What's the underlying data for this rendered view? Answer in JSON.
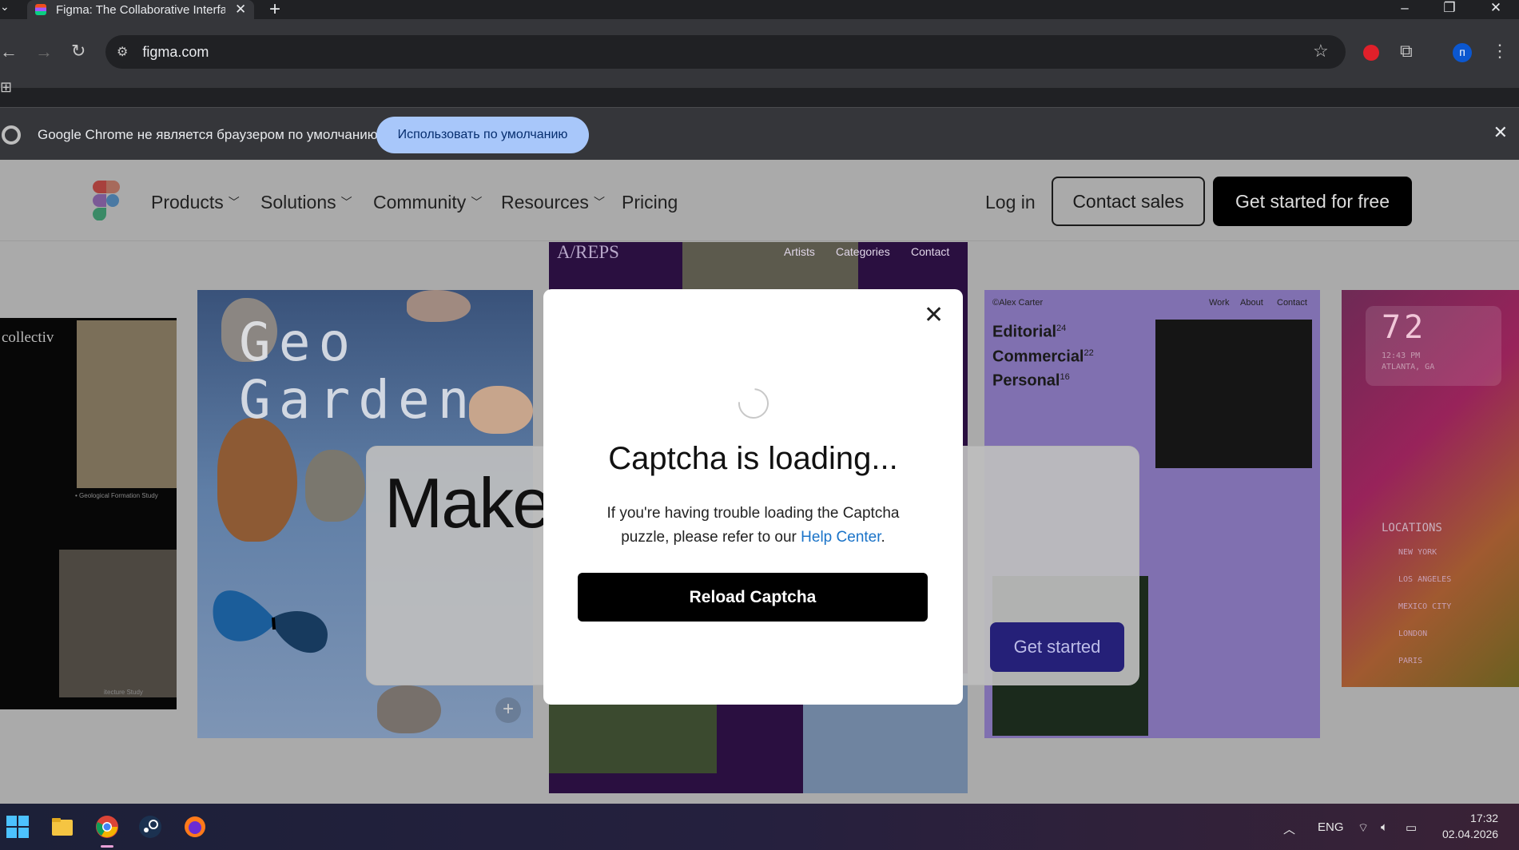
{
  "browser": {
    "tab_title": "Figma: The Collaborative Interfa",
    "new_tab": "+",
    "url": "figma.com",
    "profile_initial": "п"
  },
  "infobar": {
    "message": "Google Chrome не является браузером по умолчанию.",
    "button": "Использовать по умолчанию"
  },
  "nav": {
    "items": [
      "Products",
      "Solutions",
      "Community",
      "Resources",
      "Pricing"
    ],
    "login": "Log in",
    "contact": "Contact sales",
    "cta": "Get started for free"
  },
  "cards": {
    "collectiv_title": "collectiv",
    "collectiv_caption1": "• Geological Formation Study",
    "collectiv_caption2": "itecture Study",
    "geo_title_line1": "Geo",
    "geo_title_line2": "Garden",
    "areps_logo": "A/REPS",
    "areps_menu": [
      "Artists",
      "Categories",
      "Contact"
    ],
    "alex_name": "©Alex Carter",
    "alex_menu": [
      "Work",
      "About",
      "Contact"
    ],
    "alex_lines": [
      {
        "label": "Editorial",
        "count": "24"
      },
      {
        "label": "Commercial",
        "count": "22"
      },
      {
        "label": "Personal",
        "count": "16"
      }
    ],
    "clock_num": "72",
    "clock_time": "12:43 PM",
    "clock_city": "ATLANTA, GA",
    "locations_title": "LOCATIONS",
    "locations": [
      "NEW YORK",
      "LOS ANGELES",
      "MEXICO CITY",
      "LONDON",
      "PARIS"
    ]
  },
  "hero": {
    "make_text": "Make",
    "get_started": "Get started"
  },
  "modal": {
    "title": "Captcha is loading...",
    "text_before": "If you're having trouble loading the Captcha puzzle, please refer to our ",
    "link": "Help Center",
    "text_after": ".",
    "button": "Reload Captcha"
  },
  "taskbar": {
    "lang": "ENG",
    "time": "17:32",
    "date": "02.04.2026"
  }
}
